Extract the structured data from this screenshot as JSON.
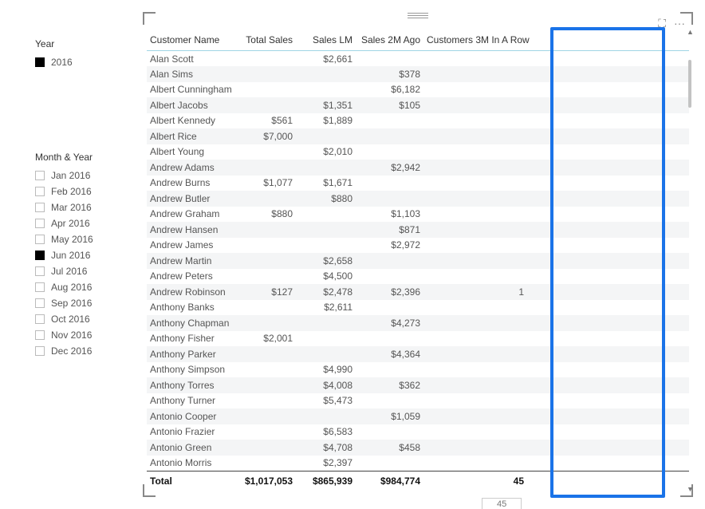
{
  "slicers": {
    "year": {
      "title": "Year",
      "items": [
        {
          "label": "2016",
          "checked": true
        }
      ]
    },
    "month": {
      "title": "Month & Year",
      "items": [
        {
          "label": "Jan 2016",
          "checked": false
        },
        {
          "label": "Feb 2016",
          "checked": false
        },
        {
          "label": "Mar 2016",
          "checked": false
        },
        {
          "label": "Apr 2016",
          "checked": false
        },
        {
          "label": "May 2016",
          "checked": false
        },
        {
          "label": "Jun 2016",
          "checked": true
        },
        {
          "label": "Jul 2016",
          "checked": false
        },
        {
          "label": "Aug 2016",
          "checked": false
        },
        {
          "label": "Sep 2016",
          "checked": false
        },
        {
          "label": "Oct 2016",
          "checked": false
        },
        {
          "label": "Nov 2016",
          "checked": false
        },
        {
          "label": "Dec 2016",
          "checked": false
        }
      ]
    }
  },
  "table": {
    "headers": {
      "customer": "Customer Name",
      "totalSales": "Total Sales",
      "salesLM": "Sales LM",
      "sales2M": "Sales 2M Ago",
      "cust3M": "Customers 3M In A Row"
    },
    "rows": [
      {
        "customer": "Alan Scott",
        "totalSales": "",
        "salesLM": "$2,661",
        "sales2M": "",
        "cust3M": ""
      },
      {
        "customer": "Alan Sims",
        "totalSales": "",
        "salesLM": "",
        "sales2M": "$378",
        "cust3M": ""
      },
      {
        "customer": "Albert Cunningham",
        "totalSales": "",
        "salesLM": "",
        "sales2M": "$6,182",
        "cust3M": ""
      },
      {
        "customer": "Albert Jacobs",
        "totalSales": "",
        "salesLM": "$1,351",
        "sales2M": "$105",
        "cust3M": ""
      },
      {
        "customer": "Albert Kennedy",
        "totalSales": "$561",
        "salesLM": "$1,889",
        "sales2M": "",
        "cust3M": ""
      },
      {
        "customer": "Albert Rice",
        "totalSales": "$7,000",
        "salesLM": "",
        "sales2M": "",
        "cust3M": ""
      },
      {
        "customer": "Albert Young",
        "totalSales": "",
        "salesLM": "$2,010",
        "sales2M": "",
        "cust3M": ""
      },
      {
        "customer": "Andrew Adams",
        "totalSales": "",
        "salesLM": "",
        "sales2M": "$2,942",
        "cust3M": ""
      },
      {
        "customer": "Andrew Burns",
        "totalSales": "$1,077",
        "salesLM": "$1,671",
        "sales2M": "",
        "cust3M": ""
      },
      {
        "customer": "Andrew Butler",
        "totalSales": "",
        "salesLM": "$880",
        "sales2M": "",
        "cust3M": ""
      },
      {
        "customer": "Andrew Graham",
        "totalSales": "$880",
        "salesLM": "",
        "sales2M": "$1,103",
        "cust3M": ""
      },
      {
        "customer": "Andrew Hansen",
        "totalSales": "",
        "salesLM": "",
        "sales2M": "$871",
        "cust3M": ""
      },
      {
        "customer": "Andrew James",
        "totalSales": "",
        "salesLM": "",
        "sales2M": "$2,972",
        "cust3M": ""
      },
      {
        "customer": "Andrew Martin",
        "totalSales": "",
        "salesLM": "$2,658",
        "sales2M": "",
        "cust3M": ""
      },
      {
        "customer": "Andrew Peters",
        "totalSales": "",
        "salesLM": "$4,500",
        "sales2M": "",
        "cust3M": ""
      },
      {
        "customer": "Andrew Robinson",
        "totalSales": "$127",
        "salesLM": "$2,478",
        "sales2M": "$2,396",
        "cust3M": "1"
      },
      {
        "customer": "Anthony Banks",
        "totalSales": "",
        "salesLM": "$2,611",
        "sales2M": "",
        "cust3M": ""
      },
      {
        "customer": "Anthony Chapman",
        "totalSales": "",
        "salesLM": "",
        "sales2M": "$4,273",
        "cust3M": ""
      },
      {
        "customer": "Anthony Fisher",
        "totalSales": "$2,001",
        "salesLM": "",
        "sales2M": "",
        "cust3M": ""
      },
      {
        "customer": "Anthony Parker",
        "totalSales": "",
        "salesLM": "",
        "sales2M": "$4,364",
        "cust3M": ""
      },
      {
        "customer": "Anthony Simpson",
        "totalSales": "",
        "salesLM": "$4,990",
        "sales2M": "",
        "cust3M": ""
      },
      {
        "customer": "Anthony Torres",
        "totalSales": "",
        "salesLM": "$4,008",
        "sales2M": "$362",
        "cust3M": ""
      },
      {
        "customer": "Anthony Turner",
        "totalSales": "",
        "salesLM": "$5,473",
        "sales2M": "",
        "cust3M": ""
      },
      {
        "customer": "Antonio Cooper",
        "totalSales": "",
        "salesLM": "",
        "sales2M": "$1,059",
        "cust3M": ""
      },
      {
        "customer": "Antonio Frazier",
        "totalSales": "",
        "salesLM": "$6,583",
        "sales2M": "",
        "cust3M": ""
      },
      {
        "customer": "Antonio Green",
        "totalSales": "",
        "salesLM": "$4,708",
        "sales2M": "$458",
        "cust3M": ""
      },
      {
        "customer": "Antonio Morris",
        "totalSales": "",
        "salesLM": "$2,397",
        "sales2M": "",
        "cust3M": ""
      }
    ],
    "total": {
      "label": "Total",
      "totalSales": "$1,017,053",
      "salesLM": "$865,939",
      "sales2M": "$984,774",
      "cust3M": "45"
    }
  },
  "rowIndicator": "45",
  "icons": {
    "focus": "⛶",
    "more": "···"
  },
  "chart_data": {
    "type": "table",
    "title": "",
    "columns": [
      "Customer Name",
      "Total Sales",
      "Sales LM",
      "Sales 2M Ago",
      "Customers 3M In A Row"
    ],
    "rows": [
      [
        "Alan Scott",
        null,
        2661,
        null,
        null
      ],
      [
        "Alan Sims",
        null,
        null,
        378,
        null
      ],
      [
        "Albert Cunningham",
        null,
        null,
        6182,
        null
      ],
      [
        "Albert Jacobs",
        null,
        1351,
        105,
        null
      ],
      [
        "Albert Kennedy",
        561,
        1889,
        null,
        null
      ],
      [
        "Albert Rice",
        7000,
        null,
        null,
        null
      ],
      [
        "Albert Young",
        null,
        2010,
        null,
        null
      ],
      [
        "Andrew Adams",
        null,
        null,
        2942,
        null
      ],
      [
        "Andrew Burns",
        1077,
        1671,
        null,
        null
      ],
      [
        "Andrew Butler",
        null,
        880,
        null,
        null
      ],
      [
        "Andrew Graham",
        880,
        null,
        1103,
        null
      ],
      [
        "Andrew Hansen",
        null,
        null,
        871,
        null
      ],
      [
        "Andrew James",
        null,
        null,
        2972,
        null
      ],
      [
        "Andrew Martin",
        null,
        2658,
        null,
        null
      ],
      [
        "Andrew Peters",
        null,
        4500,
        null,
        null
      ],
      [
        "Andrew Robinson",
        127,
        2478,
        2396,
        1
      ],
      [
        "Anthony Banks",
        null,
        2611,
        null,
        null
      ],
      [
        "Anthony Chapman",
        null,
        null,
        4273,
        null
      ],
      [
        "Anthony Fisher",
        2001,
        null,
        null,
        null
      ],
      [
        "Anthony Parker",
        null,
        null,
        4364,
        null
      ],
      [
        "Anthony Simpson",
        null,
        4990,
        null,
        null
      ],
      [
        "Anthony Torres",
        null,
        4008,
        362,
        null
      ],
      [
        "Anthony Turner",
        null,
        5473,
        null,
        null
      ],
      [
        "Antonio Cooper",
        null,
        null,
        1059,
        null
      ],
      [
        "Antonio Frazier",
        null,
        6583,
        null,
        null
      ],
      [
        "Antonio Green",
        null,
        4708,
        458,
        null
      ],
      [
        "Antonio Morris",
        null,
        2397,
        null,
        null
      ]
    ],
    "totals": {
      "Total Sales": 1017053,
      "Sales LM": 865939,
      "Sales 2M Ago": 984774,
      "Customers 3M In A Row": 45
    },
    "filters": {
      "Year": [
        2016
      ],
      "Month & Year": [
        "Jun 2016"
      ]
    }
  }
}
